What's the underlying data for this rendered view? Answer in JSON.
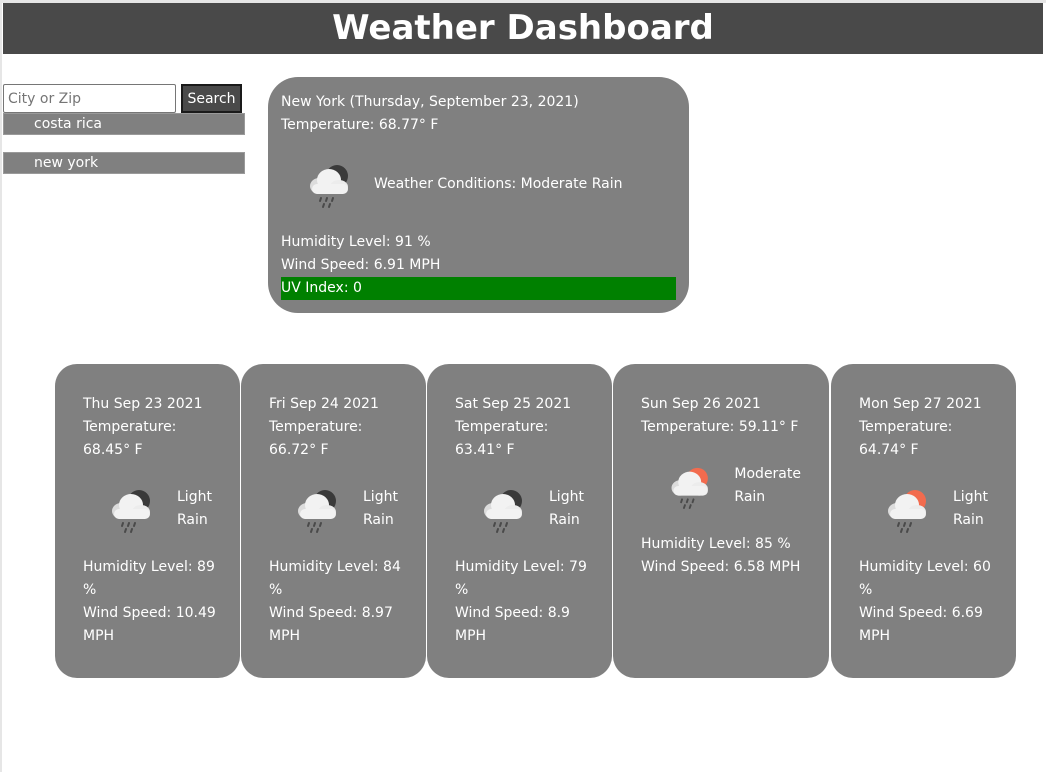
{
  "header": {
    "title": "Weather Dashboard"
  },
  "search": {
    "placeholder": "City or Zip",
    "value": "",
    "button_label": "Search"
  },
  "history": [
    {
      "label": "costa rica"
    },
    {
      "label": "new york"
    }
  ],
  "current": {
    "location_date": "New York (Thursday, September 23, 2021)",
    "temperature": "Temperature: 68.77° F",
    "conditions": "Weather Conditions: Moderate Rain",
    "humidity": "Humidity Level: 91 %",
    "wind": "Wind Speed: 6.91 MPH",
    "uv": "UV Index: 0",
    "icon": "night-rain-cloud-icon",
    "uv_color": "#008000"
  },
  "forecast": [
    {
      "date": "Thu Sep 23 2021",
      "temp_label": "Temperature:",
      "temp_value": "68.45° F",
      "cond_1": "Light",
      "cond_2": "Rain",
      "humidity_1": "Humidity Level: 89",
      "humidity_2": "%",
      "wind_1": "Wind Speed: 10.49",
      "wind_2": "MPH",
      "icon": "night-rain-cloud-icon"
    },
    {
      "date": "Fri Sep 24 2021",
      "temp_label": "Temperature:",
      "temp_value": "66.72° F",
      "cond_1": "Light",
      "cond_2": "Rain",
      "humidity_1": "Humidity Level: 84",
      "humidity_2": "%",
      "wind_1": "Wind Speed: 8.97",
      "wind_2": "MPH",
      "icon": "night-rain-cloud-icon"
    },
    {
      "date": "Sat Sep 25 2021",
      "temp_label": "Temperature:",
      "temp_value": "63.41° F",
      "cond_1": "Light",
      "cond_2": "Rain",
      "humidity_1": "Humidity Level: 79",
      "humidity_2": "%",
      "wind_1": "Wind Speed: 8.9",
      "wind_2": "MPH",
      "icon": "night-rain-cloud-icon"
    },
    {
      "date": "Sun Sep 26 2021",
      "temp_label": "Temperature: 59.11° F",
      "cond_1": "Moderate",
      "cond_2": "Rain",
      "humidity_1": "Humidity Level: 85 %",
      "wind_1": "Wind Speed: 6.58 MPH",
      "icon": "day-rain-cloud-icon"
    },
    {
      "date": "Mon Sep 27 2021",
      "temp_label": "Temperature:",
      "temp_value": "64.74° F",
      "cond_1": "Light",
      "cond_2": "Rain",
      "humidity_1": "Humidity Level: 60",
      "humidity_2": "%",
      "wind_1": "Wind Speed: 6.69",
      "wind_2": "MPH",
      "icon": "day-rain-cloud-icon"
    }
  ],
  "colors": {
    "header_bg": "#494949",
    "card_bg": "#808080",
    "sun": "#f26b4e",
    "moon": "#3a3a3a"
  }
}
